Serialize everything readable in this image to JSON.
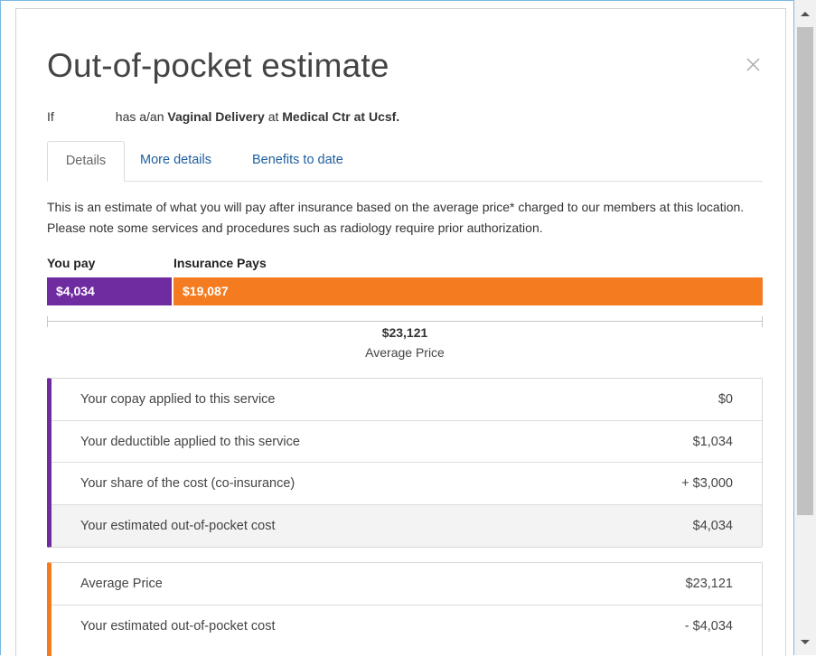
{
  "modal": {
    "title": "Out-of-pocket estimate",
    "subtitle": {
      "prefix": "If",
      "middle": "has a/an",
      "procedure": "Vaginal Delivery",
      "connector": "at",
      "facility": "Medical Ctr at Ucsf."
    }
  },
  "tabs": [
    {
      "label": "Details",
      "active": true
    },
    {
      "label": "More details",
      "active": false
    },
    {
      "label": "Benefits to date",
      "active": false
    }
  ],
  "description": "This is an estimate of what you will pay after insurance based on the average price* charged to our members at this location. Please note some services and procedures such as radiology require prior authorization.",
  "cost_bar": {
    "you_pay_label": "You pay",
    "insurance_label": "Insurance Pays",
    "you_pay_value": "$4,034",
    "insurance_value": "$19,087",
    "you_pay_amount": 4034,
    "insurance_amount": 19087,
    "total_value": "$23,121",
    "total_label": "Average Price"
  },
  "breakdown": [
    {
      "label": "Your copay applied to this service",
      "value": "$0"
    },
    {
      "label": "Your deductible applied to this service",
      "value": "$1,034"
    },
    {
      "label": "Your share of the cost (co-insurance)",
      "value": "+ $3,000"
    },
    {
      "label": "Your estimated out-of-pocket cost",
      "value": "$4,034"
    }
  ],
  "insurance_breakdown": [
    {
      "label": "Average Price",
      "value": "$23,121"
    },
    {
      "label": "Your estimated out-of-pocket cost",
      "value": "- $4,034"
    }
  ],
  "colors": {
    "you_pay": "#6f2ba0",
    "insurance": "#f47b20",
    "link": "#1f5f9f"
  },
  "icons": {
    "close": "close-icon",
    "scroll_up": "arrow-up-icon",
    "scroll_down": "arrow-down-icon"
  }
}
